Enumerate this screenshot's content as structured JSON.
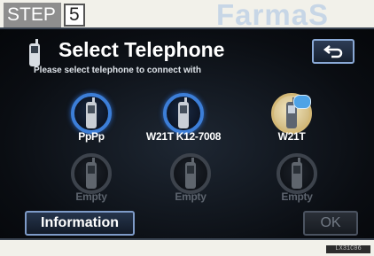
{
  "step": {
    "word": "STEP",
    "number": "5"
  },
  "watermark": "FarmaS",
  "screen": {
    "title": "Select Telephone",
    "title_icon": "phone-icon",
    "back_icon": "return-arrow-icon",
    "subtitle": "Please select telephone to connect with",
    "phones": [
      {
        "label": "PpPp",
        "state": "registered"
      },
      {
        "label": "W21T K12-7008",
        "state": "registered"
      },
      {
        "label": "W21T",
        "state": "connected",
        "badge_icon": "bluetooth-icon"
      },
      {
        "label": "Empty",
        "state": "empty"
      },
      {
        "label": "Empty",
        "state": "empty"
      },
      {
        "label": "Empty",
        "state": "empty"
      }
    ],
    "info_button": "Information",
    "ok_button": "OK"
  },
  "image_code": "LX31C06"
}
